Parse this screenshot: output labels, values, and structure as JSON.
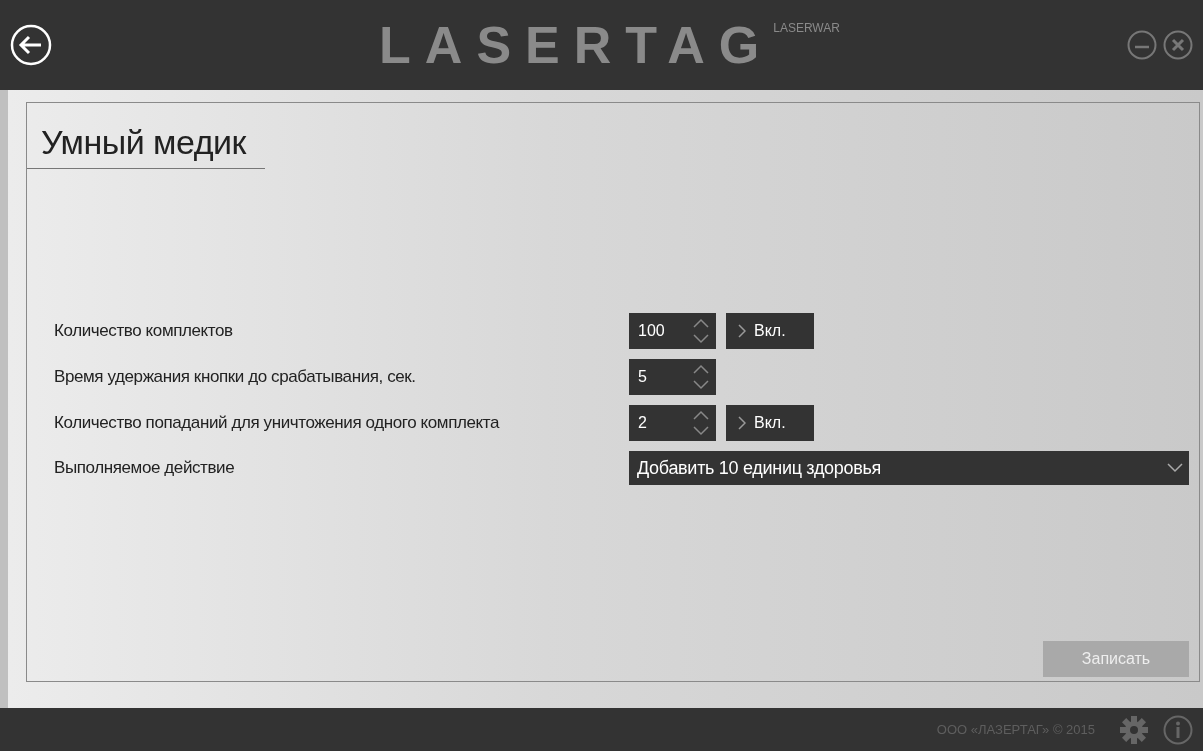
{
  "header": {
    "logo": "LASERTAG",
    "brand": "LASERWAR"
  },
  "panel": {
    "title": "Умный медик",
    "settings": [
      {
        "kind": "spinner",
        "label": "Количество комплектов",
        "value": "100",
        "toggle": "Вкл."
      },
      {
        "kind": "spinner",
        "label": "Время удержания кнопки до срабатывания, сек.",
        "value": "5"
      },
      {
        "kind": "spinner",
        "label": "Количество попаданий для уничтожения одного комплекта",
        "value": "2",
        "toggle": "Вкл."
      },
      {
        "kind": "dropdown",
        "label": "Выполняемое действие",
        "value": "Добавить 10 единиц здоровья"
      }
    ],
    "save_button": {
      "label": "Записать",
      "disabled": true
    }
  },
  "footer": {
    "copyright": "ООО «ЛАЗЕРТАГ» © 2015"
  }
}
